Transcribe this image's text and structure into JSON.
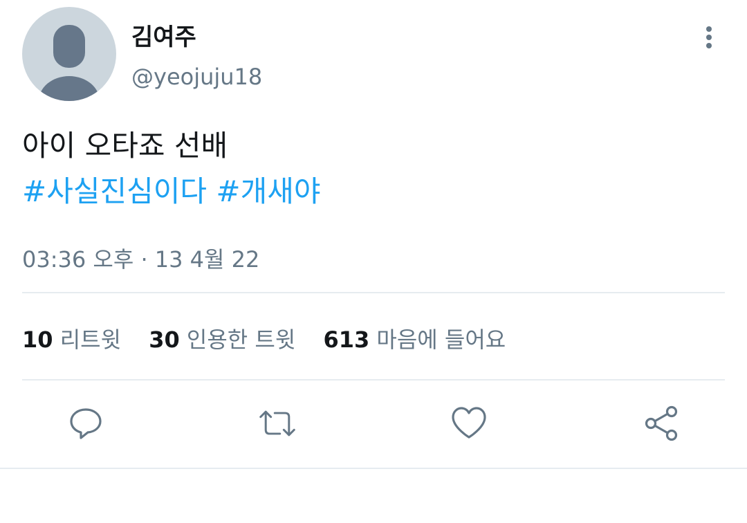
{
  "user": {
    "display_name": "김여주",
    "handle": "@yeojuju18",
    "avatar_icon": "default-avatar-icon"
  },
  "tweet": {
    "text": "아이 오타죠 선배",
    "hashtags": [
      "#사실진심이다",
      "#개새야"
    ],
    "timestamp": "03:36 오후 · 13 4월 22"
  },
  "stats": {
    "retweets": {
      "count": "10",
      "label": "리트윗"
    },
    "quotes": {
      "count": "30",
      "label": "인용한 트윗"
    },
    "likes": {
      "count": "613",
      "label": "마음에 들어요"
    }
  },
  "actions": {
    "reply_icon": "reply-icon",
    "retweet_icon": "retweet-icon",
    "like_icon": "heart-icon",
    "share_icon": "share-icon",
    "more_icon": "more-vertical-icon"
  },
  "colors": {
    "hashtag": "#1da1f2",
    "secondary_text": "#657786",
    "icon": "#657786",
    "divider": "#e6ecf0",
    "avatar_bg": "#ccd6dd",
    "avatar_fg": "#66778a"
  }
}
